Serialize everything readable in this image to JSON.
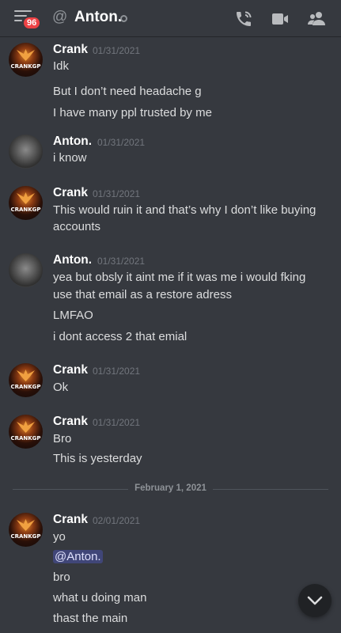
{
  "header": {
    "unread_badge": "96",
    "at_symbol": "@",
    "channel_name": "Anton.",
    "icons": [
      "hamburger-menu-icon",
      "voice-call-icon",
      "video-call-icon",
      "members-icon"
    ]
  },
  "colors": {
    "background": "#36393f",
    "badge": "#ed4245",
    "mention_bg": "#5865f2",
    "text": "#dcddde",
    "timestamp": "#72767d"
  },
  "messages": [
    {
      "author": "Crank",
      "time": "01/31/2021",
      "lines": [
        "Idk",
        "But I don’t need headache g",
        "I have many ppl trusted by me"
      ]
    },
    {
      "author": "Anton.",
      "time": "01/31/2021",
      "lines": [
        "i know"
      ]
    },
    {
      "author": "Crank",
      "time": "01/31/2021",
      "lines": [
        "This would ruin it and that’s why I don’t like buying",
        "accounts"
      ]
    },
    {
      "author": "Anton.",
      "time": "01/31/2021",
      "lines": [
        "yea but obsly it aint me if it was me i would fking",
        "use that email as a restore adress",
        "LMFAO",
        "i dont access 2 that emial"
      ]
    },
    {
      "author": "Crank",
      "time": "01/31/2021",
      "lines": [
        "Ok"
      ]
    },
    {
      "author": "Crank",
      "time": "01/31/2021",
      "lines": [
        "Bro",
        "This is yesterday"
      ]
    },
    {
      "author": "Crank",
      "time": "02/01/2021",
      "lines": [
        "yo",
        "@Anton.",
        "bro",
        "what u doing man",
        "thast the main"
      ]
    }
  ],
  "date_divider": "February 1, 2021",
  "avatar_text": "CRANKGP",
  "jump_button_icon": "chevron-down-icon"
}
